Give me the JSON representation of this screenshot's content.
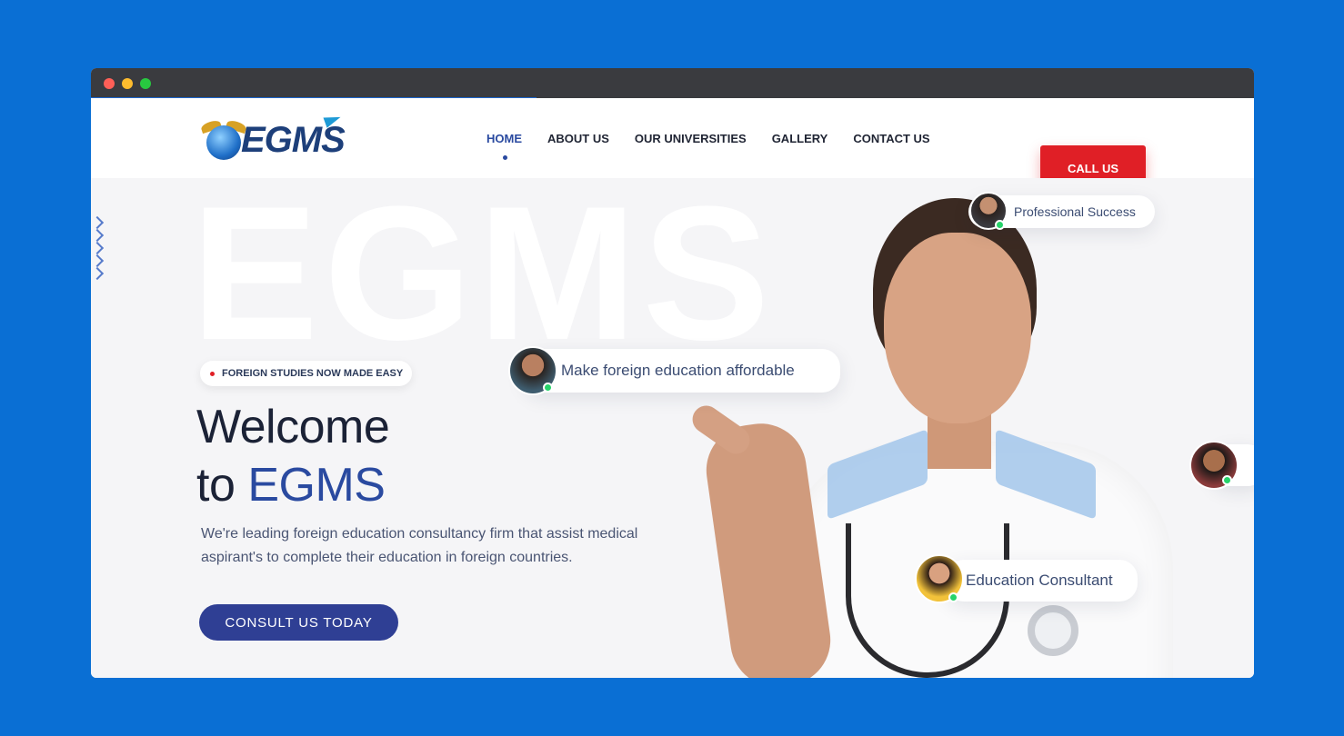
{
  "browser": {
    "traffic_lights": [
      "close",
      "minimize",
      "maximize"
    ],
    "colors": {
      "close": "#fe5f57",
      "minimize": "#febc2e",
      "maximize": "#28c840"
    }
  },
  "header": {
    "logo_text": "EGMS",
    "nav": [
      {
        "label": "HOME",
        "active": true
      },
      {
        "label": "ABOUT US",
        "active": false
      },
      {
        "label": "OUR UNIVERSITIES",
        "active": false
      },
      {
        "label": "GALLERY",
        "active": false
      },
      {
        "label": "CONTACT US",
        "active": false
      }
    ],
    "call_button": "CALL US"
  },
  "hero": {
    "watermark": "EGMS",
    "badge": "FOREIGN STUDIES NOW MADE EASY",
    "title_line1": "Welcome",
    "title_line2_prefix": "to",
    "title_line2_accent": "EGMS",
    "description": "We're leading foreign education consultancy firm that assist medical aspirant's to complete their education in foreign countries.",
    "cta": "CONSULT US TODAY",
    "floating_cards": {
      "professional": "Professional Success",
      "affordable": "Make foreign education affordable",
      "consultant": "Education Consultant"
    }
  },
  "colors": {
    "page_bg": "#0a6fd4",
    "brand_blue": "#2a4aa0",
    "cta_red": "#e01f26",
    "cta_navy": "#2f3f94",
    "online_green": "#27d36a"
  }
}
